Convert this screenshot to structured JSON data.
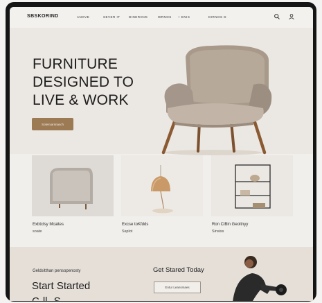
{
  "nav": {
    "logo": "SBSKORIND",
    "links": [
      "ANOVE",
      "SEVER IT",
      "DINEROVE",
      "WRNOS",
      "+ ENIS",
      "DIRNOS D"
    ],
    "icons": [
      "search-icon",
      "user-icon"
    ]
  },
  "hero": {
    "headline": [
      "FURNITURE",
      "DESIGNED TO",
      "LIVE & WORK"
    ],
    "cta_label": "Sotesvarsnasch"
  },
  "products": [
    {
      "name": "Exbtctsy Mcaites",
      "sub": "soate",
      "image": "side-table"
    },
    {
      "name": "Excse toKfdds",
      "sub": "Ssplot",
      "image": "pendant-lamp"
    },
    {
      "name": "Ron CiBin Geoltnyy",
      "sub": "Sinsiss",
      "image": "shelving-unit"
    }
  ],
  "band": {
    "eyebrow": "Geldsitthan pensopenosty",
    "big": "Start Started",
    "cut": "C-ll- S",
    "title": "Get Stared Today",
    "input_placeholder": "Entur Leansmaes"
  },
  "colors": {
    "accent": "#9b7a54",
    "hero_bg": "#ebe7e2",
    "band_bg": "#e5dfd8",
    "frame": "#151515"
  }
}
